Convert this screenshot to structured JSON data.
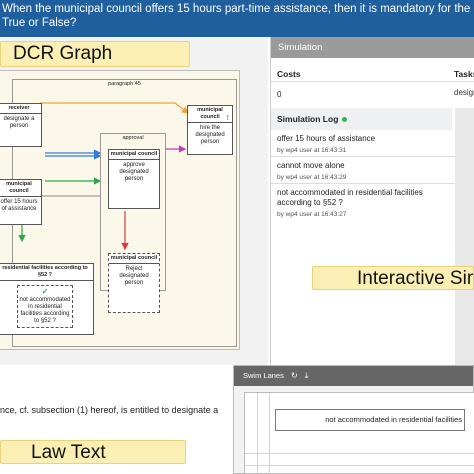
{
  "header": {
    "question_line1": "When the municipal council offers 15 hours part-time assistance, then it is mandatory for the receiver",
    "question_line2": "True or False?"
  },
  "labels": {
    "dcr_graph": "DCR Graph",
    "interactive_sim": "Interactive Simulation",
    "law_text": "Law Text"
  },
  "dcr": {
    "paragraph": "paragraph 45",
    "nest_approval": "approval",
    "events": {
      "receiver": {
        "role": "receiver",
        "text": "designate a person"
      },
      "council_top": {
        "role": "municipal council",
        "text": "hire the designated person"
      },
      "council_mid": {
        "role": "municipal council",
        "text": "approve designated person"
      },
      "council_left": {
        "role": "municipal council",
        "text": "offer 15 hours of assistance"
      },
      "council_bottom": {
        "role": "municipal council",
        "text": "Reject designated person"
      },
      "facility": {
        "role": "residential facilities according to §52 ?",
        "text": "not accommodated in residential facilities according to §52 ?"
      }
    },
    "mark_warning": "!",
    "mark_check": "✓"
  },
  "simulation": {
    "panel_title": "Simulation",
    "costs_label": "Costs",
    "tasks_label": "Tasks",
    "costs_value": "0",
    "task_value": "designate",
    "log_title": "Simulation Log",
    "log": [
      {
        "text": "offer 15 hours of assistance",
        "meta": "by wp4 user at 16:43:31"
      },
      {
        "text": "cannot move alone",
        "meta": "by wp4 user at 16:43:29"
      },
      {
        "text": "not accommodated in residential facilities according to §52 ?",
        "meta": "by wp4 user at 16:43:27"
      }
    ]
  },
  "swimlanes": {
    "title": "Swim Lanes",
    "refresh_icon": "↻",
    "download_icon": "⤓",
    "task": "not accommodated in residential facilities"
  },
  "law": {
    "text": "nce, cf. subsection (1) hereof, is entitled to designate a"
  },
  "colors": {
    "header_bg": "#1f5f9e",
    "label_bg": "#fcefb3",
    "arrow_blue": "#2f7bd8",
    "arrow_orange": "#f0a23a",
    "arrow_red": "#e03a3a",
    "arrow_green": "#2aa84a",
    "arrow_magenta": "#c23bb8",
    "status_green": "#2db84d"
  }
}
